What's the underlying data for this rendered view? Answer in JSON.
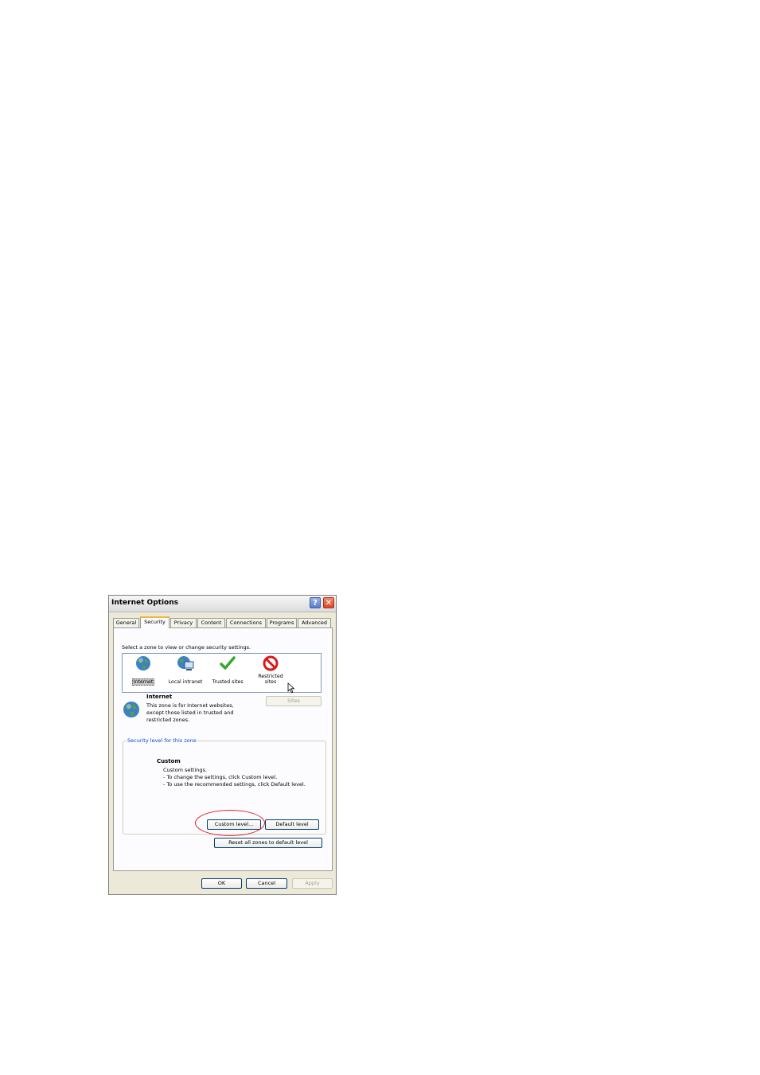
{
  "window": {
    "title": "Internet Options",
    "help_glyph": "?",
    "close_glyph": "✕"
  },
  "tabs": [
    {
      "label": "General"
    },
    {
      "label": "Security",
      "active": true
    },
    {
      "label": "Privacy"
    },
    {
      "label": "Content"
    },
    {
      "label": "Connections"
    },
    {
      "label": "Programs"
    },
    {
      "label": "Advanced"
    }
  ],
  "security": {
    "prompt": "Select a zone to view or change security settings.",
    "zones": [
      {
        "label": "Internet",
        "icon": "globe-icon",
        "selected": true
      },
      {
        "label": "Local intranet",
        "icon": "intranet-icon"
      },
      {
        "label": "Trusted sites",
        "icon": "checkmark-icon"
      },
      {
        "label_line1": "Restricted",
        "label_line2": "sites",
        "icon": "restricted-icon"
      }
    ],
    "zone_title": "Internet",
    "zone_desc": [
      "This zone is for Internet websites,",
      "except those listed in trusted and",
      "restricted zones."
    ],
    "sites_button": "Sites",
    "group_label": "Security level for this zone",
    "level_title": "Custom",
    "level_desc": [
      "Custom settings.",
      "- To change the settings, click Custom level.",
      "- To use the recommended settings, click Default level."
    ],
    "custom_level_button": "Custom level...",
    "default_level_button": "Default level",
    "reset_button": "Reset all zones to default level"
  },
  "footer": {
    "ok": "OK",
    "cancel": "Cancel",
    "apply": "Apply"
  },
  "colors": {
    "highlight_circle": "#d22222",
    "active_tab_accent": "#f0b740"
  }
}
